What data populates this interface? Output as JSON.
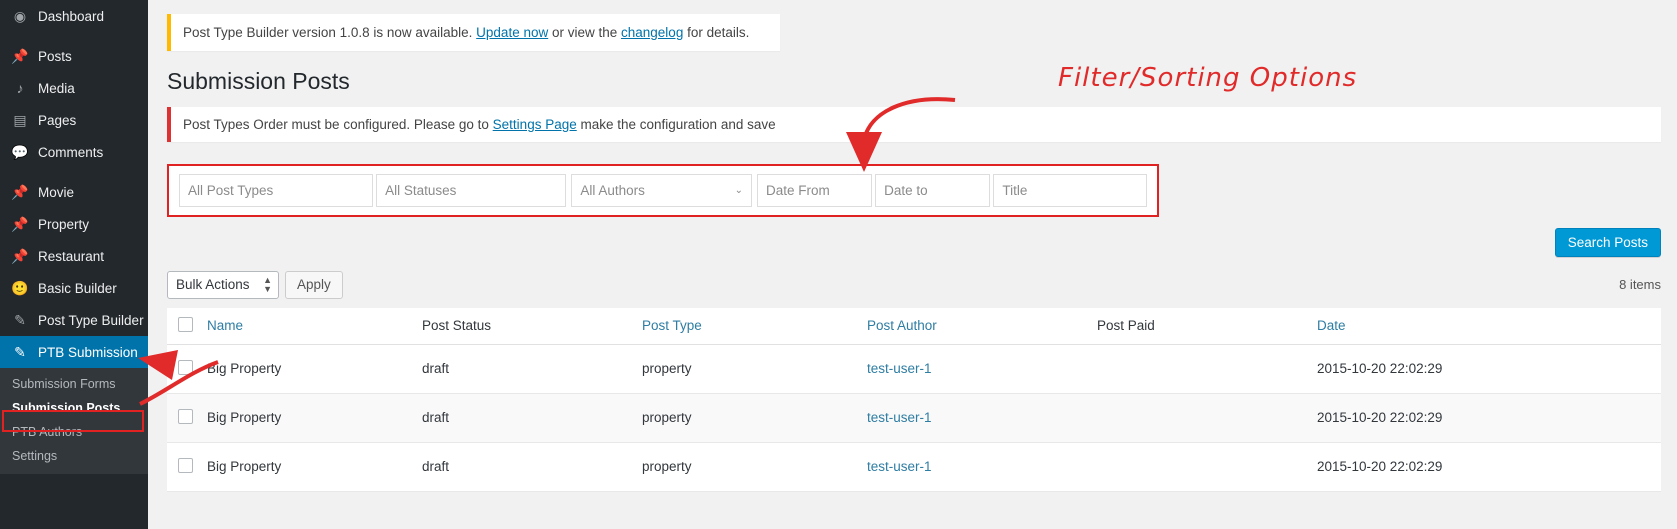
{
  "sidebar": {
    "items": [
      {
        "label": "Dashboard",
        "icon": "dashboard-icon",
        "glyph": "◉"
      },
      {
        "label": "Posts",
        "icon": "pin-icon",
        "glyph": "📌"
      },
      {
        "label": "Media",
        "icon": "media-icon",
        "glyph": "♪"
      },
      {
        "label": "Pages",
        "icon": "pages-icon",
        "glyph": "▤"
      },
      {
        "label": "Comments",
        "icon": "comments-icon",
        "glyph": "💬"
      },
      {
        "label": "Movie",
        "icon": "pin-icon",
        "glyph": "📌"
      },
      {
        "label": "Property",
        "icon": "pin-icon",
        "glyph": "📌"
      },
      {
        "label": "Restaurant",
        "icon": "pin-icon",
        "glyph": "📌"
      },
      {
        "label": "Basic Builder",
        "icon": "smiley-icon",
        "glyph": "🙂"
      },
      {
        "label": "Post Type Builder",
        "icon": "edit-icon",
        "glyph": "✎"
      },
      {
        "label": "PTB Submission",
        "icon": "edit-icon",
        "glyph": "✎"
      }
    ],
    "current_item": "PTB Submission",
    "submenu": [
      {
        "label": "Submission Forms",
        "active": false
      },
      {
        "label": "Submission Posts",
        "active": true
      },
      {
        "label": "PTB Authors",
        "active": false
      },
      {
        "label": "Settings",
        "active": false
      }
    ]
  },
  "update_notice": {
    "text_before": "Post Type Builder version 1.0.8 is now available. ",
    "link_update": "Update now",
    "text_middle": " or view the ",
    "link_changelog": "changelog",
    "text_after": " for details."
  },
  "page": {
    "title": "Submission Posts"
  },
  "error_notice": {
    "text_before": "Post Types Order must be configured. Please go to ",
    "link": "Settings Page",
    "text_after": " make the configuration and save"
  },
  "filters": {
    "post_types": {
      "value": "All Post Types"
    },
    "statuses": {
      "value": "All Statuses"
    },
    "authors": {
      "value": "All Authors"
    },
    "date_from": {
      "placeholder": "Date From"
    },
    "date_to": {
      "placeholder": "Date to"
    },
    "title": {
      "placeholder": "Title"
    },
    "search_button": "Search Posts"
  },
  "tablenav": {
    "bulk_actions": "Bulk Actions",
    "apply_button": "Apply",
    "items_count": "8 items"
  },
  "table": {
    "columns": [
      {
        "label": "Name",
        "sortable": true
      },
      {
        "label": "Post Status",
        "sortable": false
      },
      {
        "label": "Post Type",
        "sortable": true
      },
      {
        "label": "Post Author",
        "sortable": true
      },
      {
        "label": "Post Paid",
        "sortable": false
      },
      {
        "label": "Date",
        "sortable": true
      }
    ],
    "rows": [
      {
        "name": "Big Property",
        "post_status": "draft",
        "post_type": "property",
        "post_author": "test-user-1",
        "post_paid": "",
        "date": "2015-10-20 22:02:29"
      },
      {
        "name": "Big Property",
        "post_status": "draft",
        "post_type": "property",
        "post_author": "test-user-1",
        "post_paid": "",
        "date": "2015-10-20 22:02:29"
      },
      {
        "name": "Big Property",
        "post_status": "draft",
        "post_type": "property",
        "post_author": "test-user-1",
        "post_paid": "",
        "date": "2015-10-20 22:02:29"
      }
    ]
  },
  "annotations": {
    "filter_sorting_label": "Filter/Sorting Options"
  },
  "colors": {
    "sidebar_bg": "#23282d",
    "sidebar_active": "#0073aa",
    "accent_blue": "#0099d5",
    "link_blue": "#2e7da3",
    "annotation_red": "#e12a2a",
    "notice_warning": "#ffb900",
    "notice_error": "#dc3232"
  }
}
